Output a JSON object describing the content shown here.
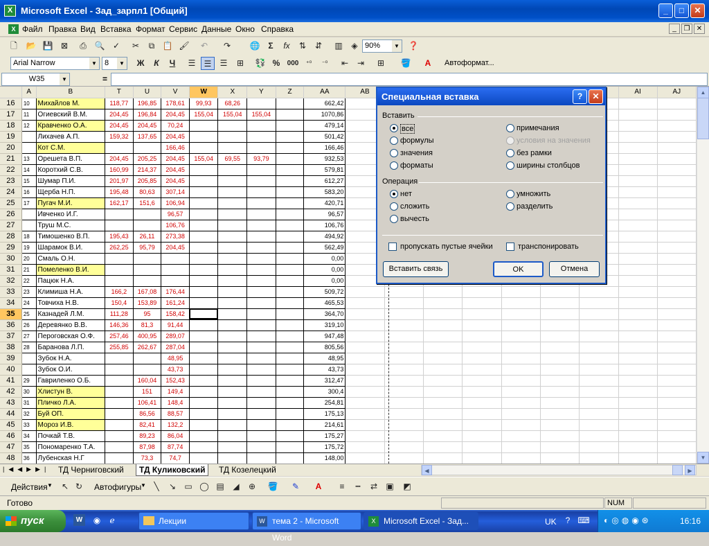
{
  "window": {
    "title": "Microsoft Excel - Зад_зарпл1  [Общий]"
  },
  "menu": [
    "Файл",
    "Правка",
    "Вид",
    "Вставка",
    "Формат",
    "Сервис",
    "Данные",
    "Окно",
    "Справка"
  ],
  "toolbar": {
    "zoom": "90%",
    "font": "Arial Narrow",
    "size": "8",
    "autoformat": "Автоформат...",
    "bold": "Ж",
    "italic": "К",
    "underline": "Ч",
    "percent": "%",
    "thousands": "000",
    "sigma": "Σ",
    "fx": "fx"
  },
  "formula_bar": {
    "name_box": "W35",
    "equals": "=",
    "content": ""
  },
  "columns": [
    "A",
    "B",
    "T",
    "U",
    "V",
    "W",
    "X",
    "Y",
    "Z",
    "AA",
    "AB",
    "AC",
    "AD",
    "AE",
    "AF",
    "AG",
    "AH",
    "AI",
    "AJ"
  ],
  "rows": [
    {
      "r": "16",
      "a": "10",
      "b": "Михайлов М.",
      "hl": true,
      "t": "118,77",
      "u": "196,85",
      "v": "178,61",
      "w": "99,93",
      "x": "68,26",
      "y": "",
      "aa": "662,42"
    },
    {
      "r": "17",
      "a": "11",
      "b": "Огиевский В.М.",
      "hl": false,
      "t": "204,45",
      "u": "196,84",
      "v": "204,45",
      "w": "155,04",
      "x": "155,04",
      "y": "155,04",
      "aa": "1070,86"
    },
    {
      "r": "18",
      "a": "12",
      "b": "Кравченко О.А.",
      "hl": true,
      "t": "204,45",
      "u": "204,45",
      "v": "70,24",
      "w": "",
      "x": "",
      "y": "",
      "aa": "479,14"
    },
    {
      "r": "19",
      "a": "",
      "b": "Лихачев А.П.",
      "hl": false,
      "t": "159,32",
      "u": "137,65",
      "v": "204,45",
      "w": "",
      "x": "",
      "y": "",
      "aa": "501,42"
    },
    {
      "r": "20",
      "a": "",
      "b": "Кот С.М.",
      "hl": true,
      "t": "",
      "u": "",
      "v": "166,46",
      "w": "",
      "x": "",
      "y": "",
      "aa": "166,46"
    },
    {
      "r": "21",
      "a": "13",
      "b": "Орешета В.П.",
      "hl": false,
      "t": "204,45",
      "u": "205,25",
      "v": "204,45",
      "w": "155,04",
      "x": "69,55",
      "y": "93,79",
      "aa": "932,53"
    },
    {
      "r": "22",
      "a": "14",
      "b": "Коротхий С.В.",
      "hl": false,
      "t": "160,99",
      "u": "214,37",
      "v": "204,45",
      "w": "",
      "x": "",
      "y": "",
      "aa": "579,81"
    },
    {
      "r": "23",
      "a": "15",
      "b": "Шумар П.И.",
      "hl": false,
      "t": "201,97",
      "u": "205,85",
      "v": "204,45",
      "w": "",
      "x": "",
      "y": "",
      "aa": "612,27"
    },
    {
      "r": "24",
      "a": "16",
      "b": "Щерба Н.П.",
      "hl": false,
      "t": "195,48",
      "u": "80,63",
      "v": "307,14",
      "w": "",
      "x": "",
      "y": "",
      "aa": "583,20"
    },
    {
      "r": "25",
      "a": "17",
      "b": "Пугач М.И.",
      "hl": true,
      "t": "162,17",
      "u": "151,6",
      "v": "106,94",
      "w": "",
      "x": "",
      "y": "",
      "aa": "420,71"
    },
    {
      "r": "26",
      "a": "",
      "b": "Ивченко И.Г.",
      "hl": false,
      "t": "",
      "u": "",
      "v": "96,57",
      "w": "",
      "x": "",
      "y": "",
      "aa": "96,57"
    },
    {
      "r": "27",
      "a": "",
      "b": "Труш М.С.",
      "hl": false,
      "t": "",
      "u": "",
      "v": "106,76",
      "w": "",
      "x": "",
      "y": "",
      "aa": "106,76"
    },
    {
      "r": "28",
      "a": "18",
      "b": "Тимошенко В.П.",
      "hl": false,
      "t": "195,43",
      "u": "26,11",
      "v": "273,38",
      "w": "",
      "x": "",
      "y": "",
      "aa": "494,92"
    },
    {
      "r": "29",
      "a": "19",
      "b": "Шарамок В.И.",
      "hl": false,
      "t": "262,25",
      "u": "95,79",
      "v": "204,45",
      "w": "",
      "x": "",
      "y": "",
      "aa": "562,49"
    },
    {
      "r": "30",
      "a": "20",
      "b": "Смаль О.Н.",
      "hl": false,
      "t": "",
      "u": "",
      "v": "",
      "w": "",
      "x": "",
      "y": "",
      "aa": "0,00"
    },
    {
      "r": "31",
      "a": "21",
      "b": "Помеленко В.И.",
      "hl": true,
      "t": "",
      "u": "",
      "v": "",
      "w": "",
      "x": "",
      "y": "",
      "aa": "0,00"
    },
    {
      "r": "32",
      "a": "22",
      "b": "Пацюк Н.А.",
      "hl": false,
      "t": "",
      "u": "",
      "v": "",
      "w": "",
      "x": "",
      "y": "",
      "aa": "0,00"
    },
    {
      "r": "33",
      "a": "23",
      "b": "Климиша Н.А.",
      "hl": false,
      "t": "166,2",
      "u": "167,08",
      "v": "176,44",
      "w": "",
      "x": "",
      "y": "",
      "aa": "509,72"
    },
    {
      "r": "34",
      "a": "24",
      "b": "Товчиха Н.В.",
      "hl": false,
      "t": "150,4",
      "u": "153,89",
      "v": "161,24",
      "w": "",
      "x": "",
      "y": "",
      "aa": "465,53"
    },
    {
      "r": "35",
      "a": "25",
      "b": "Казнадей Л.М.",
      "hl": false,
      "t": "111,28",
      "u": "95",
      "v": "158,42",
      "w": "",
      "x": "",
      "y": "",
      "aa": "364,70"
    },
    {
      "r": "36",
      "a": "26",
      "b": "Деревянко В.В.",
      "hl": false,
      "t": "146,36",
      "u": "81,3",
      "v": "91,44",
      "w": "",
      "x": "",
      "y": "",
      "aa": "319,10"
    },
    {
      "r": "37",
      "a": "27",
      "b": "Пероговская О.Ф.",
      "hl": false,
      "t": "257,46",
      "u": "400,95",
      "v": "289,07",
      "w": "",
      "x": "",
      "y": "",
      "aa": "947,48"
    },
    {
      "r": "38",
      "a": "28",
      "b": "Баранова Л.П.",
      "hl": false,
      "t": "255,85",
      "u": "262,67",
      "v": "287,04",
      "w": "",
      "x": "",
      "y": "",
      "aa": "805,56"
    },
    {
      "r": "39",
      "a": "",
      "b": "Зубок Н.А.",
      "hl": false,
      "t": "",
      "u": "",
      "v": "48,95",
      "w": "",
      "x": "",
      "y": "",
      "aa": "48,95"
    },
    {
      "r": "40",
      "a": "",
      "b": "Зубок О.И.",
      "hl": false,
      "t": "",
      "u": "",
      "v": "43,73",
      "w": "",
      "x": "",
      "y": "",
      "aa": "43,73"
    },
    {
      "r": "41",
      "a": "29",
      "b": "Гавриленко О.Б.",
      "hl": false,
      "t": "",
      "u": "160,04",
      "v": "152,43",
      "w": "",
      "x": "",
      "y": "",
      "aa": "312,47"
    },
    {
      "r": "42",
      "a": "30",
      "b": "Хлистун В.",
      "hl": true,
      "t": "",
      "u": "151",
      "v": "149,4",
      "w": "",
      "x": "",
      "y": "",
      "aa": "300,4"
    },
    {
      "r": "43",
      "a": "31",
      "b": "Пличко Л.А.",
      "hl": true,
      "t": "",
      "u": "106,41",
      "v": "148,4",
      "w": "",
      "x": "",
      "y": "",
      "aa": "254,81"
    },
    {
      "r": "44",
      "a": "32",
      "b": "Буй ОП.",
      "hl": true,
      "t": "",
      "u": "86,56",
      "v": "88,57",
      "w": "",
      "x": "",
      "y": "",
      "aa": "175,13"
    },
    {
      "r": "45",
      "a": "33",
      "b": "Мороз И.В.",
      "hl": true,
      "t": "",
      "u": "82,41",
      "v": "132,2",
      "w": "",
      "x": "",
      "y": "",
      "aa": "214,61"
    },
    {
      "r": "46",
      "a": "34",
      "b": "Почкай Т.В.",
      "hl": false,
      "t": "",
      "u": "89,23",
      "v": "86,04",
      "w": "",
      "x": "",
      "y": "",
      "aa": "175,27"
    },
    {
      "r": "47",
      "a": "35",
      "b": "Пономаренко Т.А.",
      "hl": false,
      "t": "",
      "u": "87,98",
      "v": "87,74",
      "w": "",
      "x": "",
      "y": "",
      "aa": "175,72"
    },
    {
      "r": "48",
      "a": "36",
      "b": "Лубенская Н.Г",
      "hl": false,
      "t": "",
      "u": "73,3",
      "v": "74,7",
      "w": "",
      "x": "",
      "y": "",
      "aa": "148,00"
    }
  ],
  "sheet_tabs": [
    "ТД Черниговский",
    "ТД Куликовский",
    "ТД Козелецкий"
  ],
  "active_tab": "ТД Куликовский",
  "draw_toolbar": {
    "actions": "Действия",
    "autoshapes": "Автофигуры"
  },
  "status": {
    "text": "Готово",
    "num": "NUM"
  },
  "dialog": {
    "title": "Специальная вставка",
    "group_paste": "Вставить",
    "paste_options": [
      "все",
      "формулы",
      "значения",
      "форматы",
      "примечания",
      "условия на значения",
      "без рамки",
      "ширины столбцов"
    ],
    "group_op": "Операция",
    "op_options": [
      "нет",
      "сложить",
      "вычесть",
      "умножить",
      "разделить"
    ],
    "skip_blanks": "пропускать пустые ячейки",
    "transpose": "транспонировать",
    "paste_link": "Вставить связь",
    "ok": "OK",
    "cancel": "Отмена"
  },
  "taskbar": {
    "start": "пуск",
    "tasks": [
      "Лекции",
      "тема 2 - Microsoft Word",
      "Microsoft Excel - Зад..."
    ],
    "lang": "UK",
    "clock": "16:16"
  }
}
